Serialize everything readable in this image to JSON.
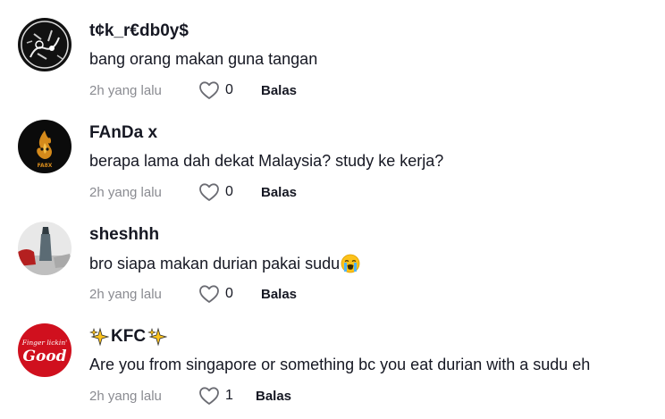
{
  "comments": [
    {
      "username": "t¢k_r€db0y$",
      "text": "bang orang makan guna tangan",
      "time": "2h yang lalu",
      "likes": "0",
      "reply": "Balas",
      "avatar_icon": "skull-art-avatar"
    },
    {
      "username": "FAnDa x",
      "text": "berapa lama dah dekat Malaysia? study ke kerja?",
      "time": "2h yang lalu",
      "likes": "0",
      "reply": "Balas",
      "avatar_icon": "flame-logo-avatar"
    },
    {
      "username": "sheshhh",
      "text": "bro siapa makan durian pakai sudu",
      "text_emoji": "loudly-crying-face",
      "time": "2h yang lalu",
      "likes": "0",
      "reply": "Balas",
      "avatar_icon": "photo-avatar"
    },
    {
      "username": "KFC",
      "username_emoji": "sparkles",
      "text": "Are you from singapore or something bc you eat durian with a sudu eh",
      "time": "2h yang lalu",
      "likes": "1",
      "reply": "Balas",
      "avatar_icon": "kfc-logo-avatar",
      "avatar_text_top": "Finger lickin'",
      "avatar_text_main": "Good"
    }
  ],
  "colors": {
    "text": "#161823",
    "muted": "#8a8b91",
    "kfc_red": "#d0101e"
  }
}
